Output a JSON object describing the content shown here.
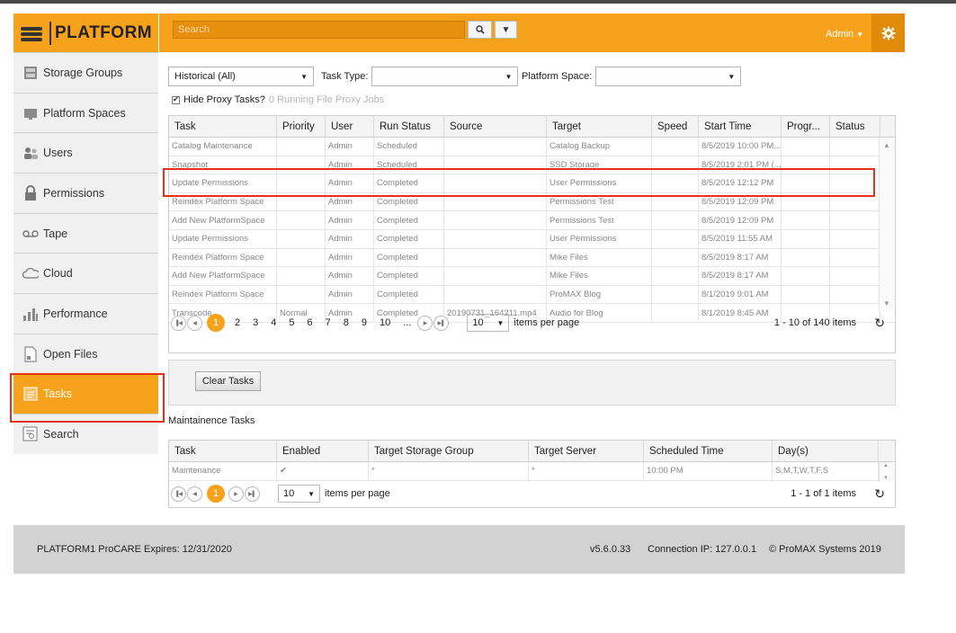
{
  "brand": {
    "name": "PLATFORM"
  },
  "header": {
    "search_placeholder": "Search",
    "search_icon": "search-icon",
    "user_label": "Admin",
    "settings_icon": "gear-icon"
  },
  "sidebar": {
    "items": [
      {
        "label": "Storage Groups",
        "icon": "storage-icon"
      },
      {
        "label": "Platform Spaces",
        "icon": "folder-icon"
      },
      {
        "label": "Users",
        "icon": "users-icon"
      },
      {
        "label": "Permissions",
        "icon": "lock-icon"
      },
      {
        "label": "Tape",
        "icon": "tape-icon"
      },
      {
        "label": "Cloud",
        "icon": "cloud-icon"
      },
      {
        "label": "Performance",
        "icon": "bar-chart-icon"
      },
      {
        "label": "Open Files",
        "icon": "file-icon"
      },
      {
        "label": "Tasks",
        "icon": "tasks-icon",
        "active": true
      },
      {
        "label": "Search",
        "icon": "search-list-icon"
      }
    ]
  },
  "filters": {
    "history_value": "Historical (All)",
    "task_type_label": "Task Type:",
    "task_type_value": "",
    "platform_space_label": "Platform Space:",
    "platform_space_value": "",
    "hide_proxy_label": "Hide Proxy Tasks?",
    "hide_proxy_checked": true,
    "running_proxy_text": "0 Running File Proxy Jobs"
  },
  "tasks_grid": {
    "columns": [
      "Task",
      "Priority",
      "User",
      "Run Status",
      "Source",
      "Target",
      "Speed",
      "Start Time",
      "Progr...",
      "Status"
    ],
    "rows": [
      [
        "Catalog Maintenance",
        "",
        "Admin",
        "Scheduled",
        "",
        "Catalog Backup",
        "",
        "8/5/2019 10:00 PM...",
        "",
        ""
      ],
      [
        "Snapshot",
        "",
        "Admin",
        "Scheduled",
        "",
        "SSD Storage",
        "",
        "8/5/2019 2:01 PM (...",
        "",
        ""
      ],
      [
        "Update Permissions",
        "",
        "Admin",
        "Completed",
        "",
        "User Permissions",
        "",
        "8/5/2019 12:12 PM",
        "",
        ""
      ],
      [
        "Reindex Platform Space",
        "",
        "Admin",
        "Completed",
        "",
        "Permissions Test",
        "",
        "8/5/2019 12:09 PM",
        "",
        ""
      ],
      [
        "Add New PlatformSpace",
        "",
        "Admin",
        "Completed",
        "",
        "Permissions Test",
        "",
        "8/5/2019 12:09 PM",
        "",
        ""
      ],
      [
        "Update Permissions",
        "",
        "Admin",
        "Completed",
        "",
        "User Permissions",
        "",
        "8/5/2019 11:55 AM",
        "",
        ""
      ],
      [
        "Reindex Platform Space",
        "",
        "Admin",
        "Completed",
        "",
        "Mike Files",
        "",
        "8/5/2019 8:17 AM",
        "",
        ""
      ],
      [
        "Add New PlatformSpace",
        "",
        "Admin",
        "Completed",
        "",
        "Mike Files",
        "",
        "8/5/2019 8:17 AM",
        "",
        ""
      ],
      [
        "Reindex Platform Space",
        "",
        "Admin",
        "Completed",
        "",
        "ProMAX Blog",
        "",
        "8/1/2019 9:01 AM",
        "",
        ""
      ],
      [
        "Transcode",
        "Normal",
        "Admin",
        "Completed",
        "20190731_164211.mp4",
        "Audio for Blog",
        "",
        "8/1/2019 8:45 AM",
        "",
        ""
      ]
    ],
    "pager": {
      "current_page": "1",
      "pages": [
        "2",
        "3",
        "4",
        "5",
        "6",
        "7",
        "8",
        "9",
        "10",
        "..."
      ],
      "page_size": "10",
      "per_page_label": "items per page",
      "summary": "1 - 10 of 140 items"
    }
  },
  "clear_button": "Clear Tasks",
  "maintenance": {
    "title": "Maintainence Tasks",
    "columns": [
      "Task",
      "Enabled",
      "Target Storage Group",
      "Target Server",
      "Scheduled Time",
      "Day(s)"
    ],
    "rows": [
      [
        "Maintenance",
        "✔",
        "*",
        "*",
        "10:00 PM",
        "S,M,T,W,T,F,S"
      ]
    ],
    "pager": {
      "current_page": "1",
      "page_size": "10",
      "per_page_label": "items per page",
      "summary": "1 - 1 of 1 items"
    }
  },
  "footer": {
    "license": "PLATFORM1 ProCARE Expires: 12/31/2020",
    "version": "v5.6.0.33",
    "connection": "Connection IP: 127.0.0.1",
    "copyright": "© ProMAX Systems 2019"
  },
  "colors": {
    "accent": "#f7a21b",
    "highlight": "#e8301c"
  }
}
